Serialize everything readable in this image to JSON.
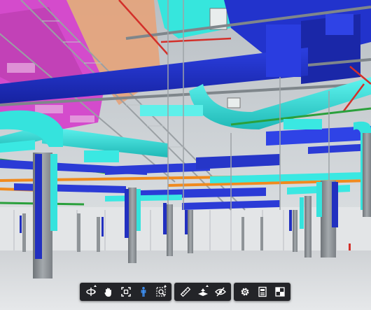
{
  "viewer": {
    "scene": "bim-mep-model-3d-view",
    "colors": {
      "duct_blue": "#2233cc",
      "duct_cyan": "#33e6e0",
      "pink_zone": "#d946c9",
      "pipe_orange": "#f08a1e",
      "pipe_green": "#2a9a3a",
      "pipe_red": "#d9302a",
      "column_grey": "#8a8f94",
      "floor": "#d7d9dc",
      "toolbar_bg": "#141619",
      "active_icon": "#3d8ef0"
    }
  },
  "toolbar": {
    "groups": [
      {
        "buttons": [
          {
            "name": "orbit",
            "icon": "orbit-icon",
            "has_menu": true
          },
          {
            "name": "pan",
            "icon": "pan-hand-icon",
            "has_menu": false
          },
          {
            "name": "fit-to-view",
            "icon": "fit-view-icon",
            "has_menu": false
          },
          {
            "name": "first-person",
            "icon": "person-walk-icon",
            "has_menu": false,
            "active": true
          },
          {
            "name": "camera",
            "icon": "camera-zoom-icon",
            "has_menu": true
          }
        ]
      },
      {
        "buttons": [
          {
            "name": "measure",
            "icon": "ruler-icon",
            "has_menu": false
          },
          {
            "name": "section",
            "icon": "section-plane-icon",
            "has_menu": true
          },
          {
            "name": "explode",
            "icon": "hide-eye-icon",
            "has_menu": false
          }
        ]
      },
      {
        "buttons": [
          {
            "name": "settings",
            "icon": "gear-icon",
            "has_menu": false
          },
          {
            "name": "model-browser",
            "icon": "model-browser-icon",
            "has_menu": false
          },
          {
            "name": "fullscreen",
            "icon": "fullscreen-icon",
            "has_menu": false
          }
        ]
      }
    ]
  }
}
